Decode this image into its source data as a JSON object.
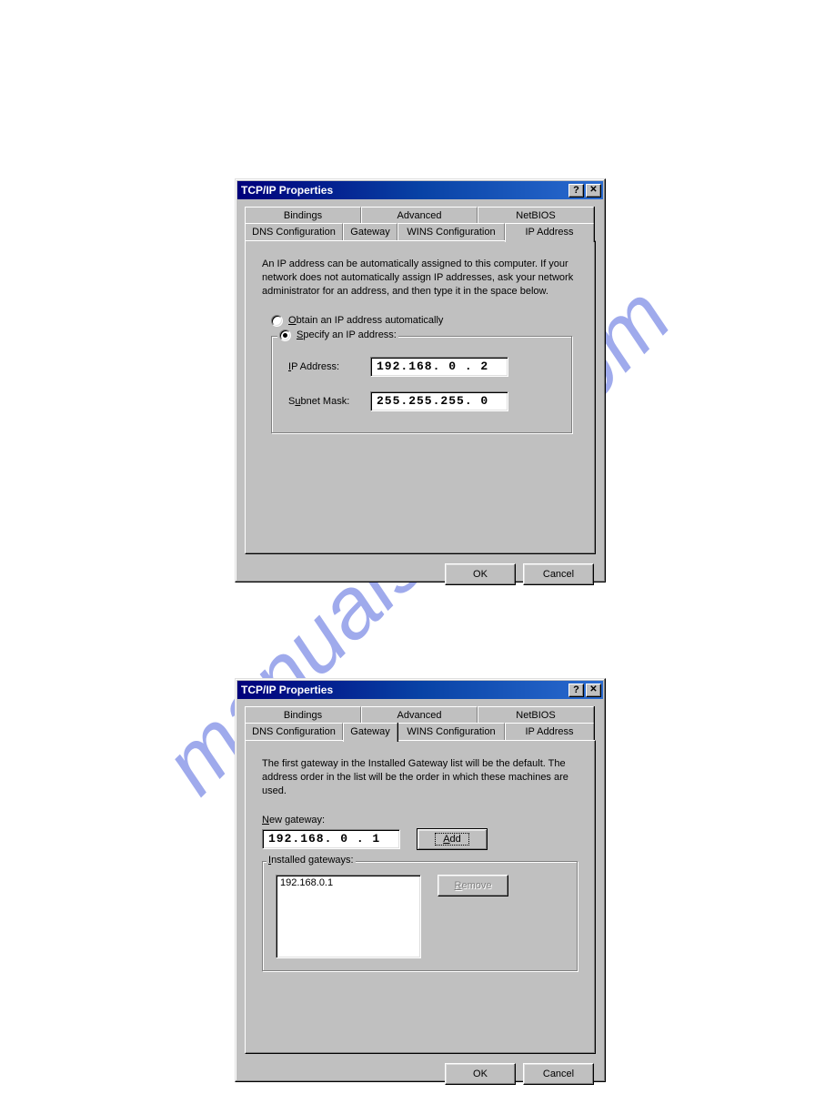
{
  "watermark": "manualshive.com",
  "dialog1": {
    "title": "TCP/IP Properties",
    "tabs_back": [
      "Bindings",
      "Advanced",
      "NetBIOS"
    ],
    "tabs_front": [
      "DNS Configuration",
      "Gateway",
      "WINS Configuration",
      "IP Address"
    ],
    "active_tab": "IP Address",
    "description": "An IP address can be automatically assigned to this computer. If your network does not automatically assign IP addresses, ask your network administrator for an address, and then type it in the space below.",
    "radio_obtain": "Obtain an IP address automatically",
    "radio_obtain_key": "O",
    "radio_specify": "Specify an IP address:",
    "radio_specify_key": "S",
    "label_ip": "IP Address:",
    "label_ip_key": "I",
    "label_subnet": "Subnet Mask:",
    "label_subnet_key": "u",
    "ip_address": "192.168. 0 . 2",
    "subnet_mask": "255.255.255. 0",
    "btn_ok": "OK",
    "btn_cancel": "Cancel"
  },
  "dialog2": {
    "title": "TCP/IP Properties",
    "tabs_back": [
      "Bindings",
      "Advanced",
      "NetBIOS"
    ],
    "tabs_front": [
      "DNS Configuration",
      "Gateway",
      "WINS Configuration",
      "IP Address"
    ],
    "active_tab": "Gateway",
    "description": "The first gateway in the Installed Gateway list will be the default. The address order in the list will be the order in which these machines are used.",
    "label_new_gateway": "New gateway:",
    "label_new_gateway_key": "N",
    "new_gateway": "192.168. 0 . 1",
    "btn_add": "Add",
    "btn_add_key": "A",
    "label_installed": "Installed gateways:",
    "label_installed_key": "I",
    "installed_gateways": [
      "192.168.0.1"
    ],
    "btn_remove": "Remove",
    "btn_remove_key": "R",
    "btn_ok": "OK",
    "btn_cancel": "Cancel"
  }
}
